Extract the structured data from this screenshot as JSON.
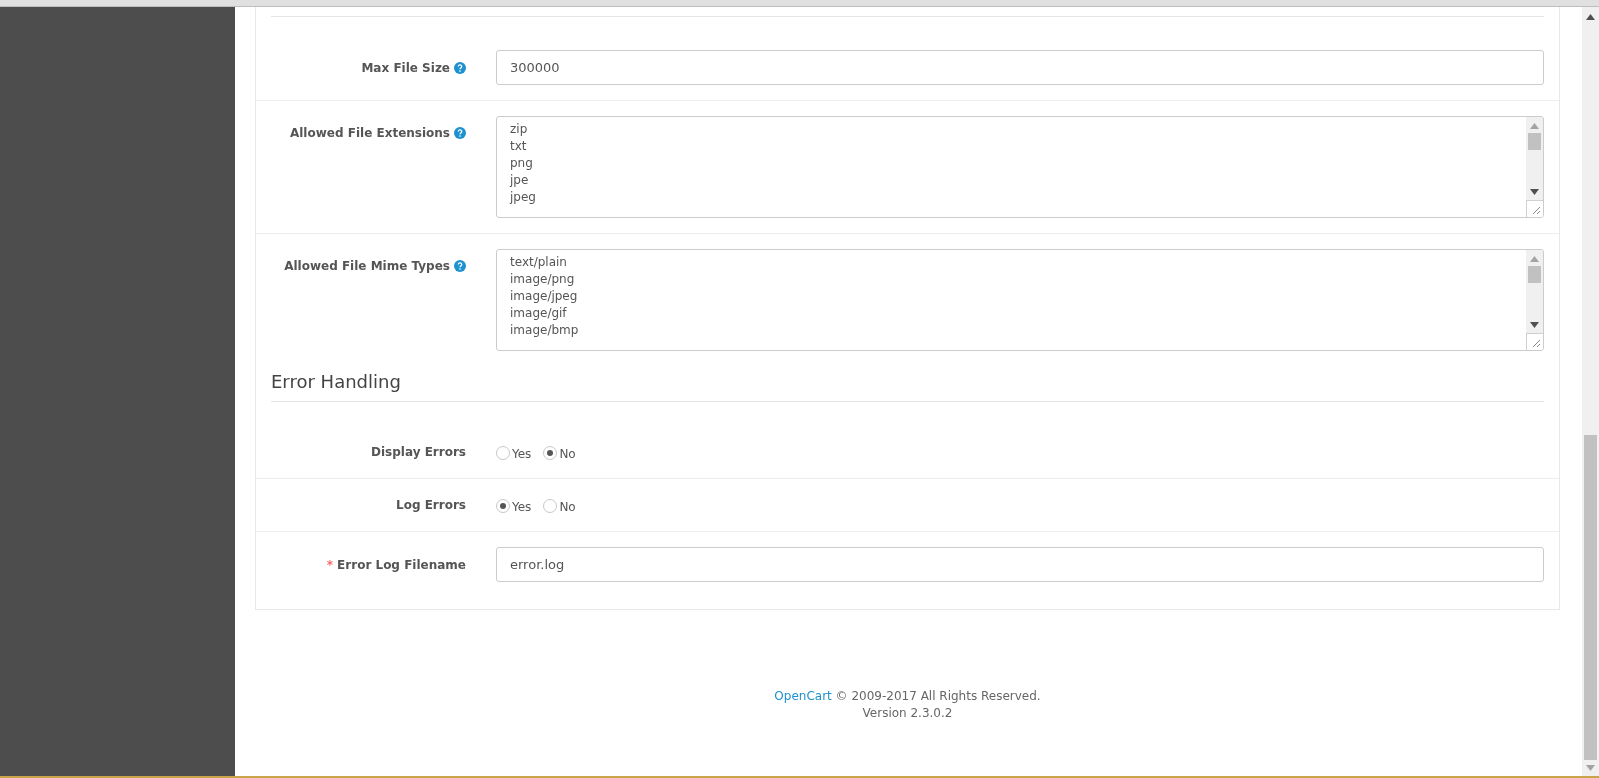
{
  "upload_fields": [
    {
      "label": "Max File Size",
      "kind": "input",
      "value": "300000",
      "help": true
    },
    {
      "label": "Allowed File Extensions",
      "kind": "textarea",
      "lines": [
        "zip",
        "txt",
        "png",
        "jpe",
        "jpeg"
      ],
      "help": true
    },
    {
      "label": "Allowed File Mime Types",
      "kind": "textarea",
      "lines": [
        "text/plain",
        "image/png",
        "image/jpeg",
        "image/gif",
        "image/bmp"
      ],
      "help": true
    }
  ],
  "error_section": {
    "title": "Error Handling",
    "fields": [
      {
        "label": "Display Errors",
        "kind": "radio",
        "required": false,
        "options": [
          {
            "label": "Yes",
            "selected": false
          },
          {
            "label": "No",
            "selected": true
          }
        ]
      },
      {
        "label": "Log Errors",
        "kind": "radio",
        "required": false,
        "options": [
          {
            "label": "Yes",
            "selected": true
          },
          {
            "label": "No",
            "selected": false
          }
        ]
      },
      {
        "label": "Error Log Filename",
        "kind": "input",
        "required": true,
        "required_mark": "*",
        "value": "error.log"
      }
    ]
  },
  "footer": {
    "link": "OpenCart",
    "text": "© 2009-2017 All Rights Reserved.",
    "version": "Version 2.3.0.2"
  }
}
